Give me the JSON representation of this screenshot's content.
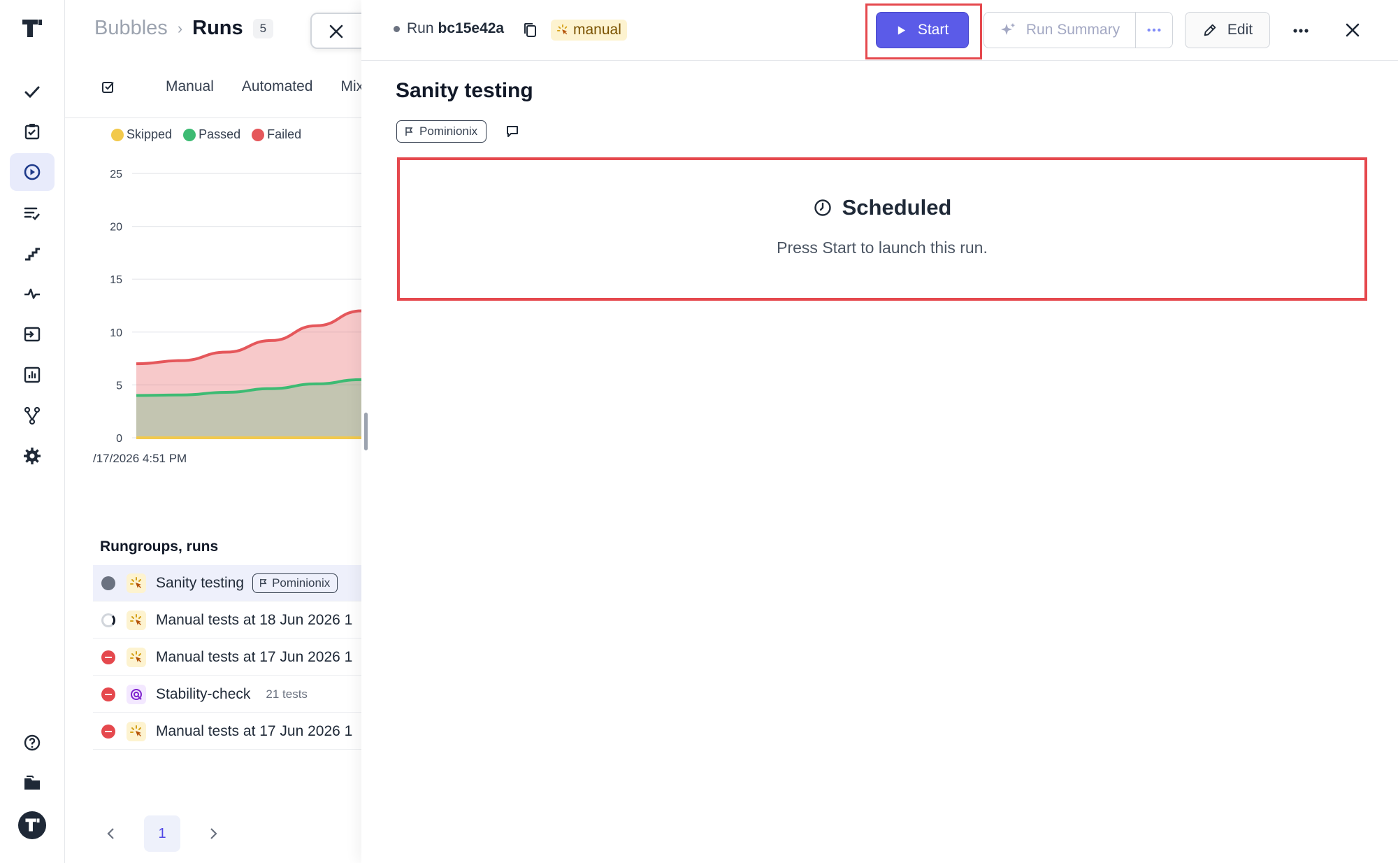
{
  "sidebar": {
    "items": [
      {
        "name": "logo-icon"
      },
      {
        "name": "checkmark-icon"
      },
      {
        "name": "clipboard-check-icon"
      },
      {
        "name": "play-circle-icon"
      },
      {
        "name": "list-check-icon"
      },
      {
        "name": "steps-icon"
      },
      {
        "name": "pulse-icon"
      },
      {
        "name": "import-icon"
      },
      {
        "name": "bar-chart-icon"
      },
      {
        "name": "branch-icon"
      },
      {
        "name": "gear-icon"
      },
      {
        "name": "help-icon"
      },
      {
        "name": "folder-icon"
      },
      {
        "name": "avatar"
      }
    ],
    "active": "play-circle-icon"
  },
  "breadcrumb": {
    "root": "Bubbles",
    "separator": "›",
    "current": "Runs",
    "count": "5"
  },
  "tabs": [
    "Manual",
    "Automated",
    "Mix"
  ],
  "legend": [
    {
      "label": "Skipped",
      "color": "#f2c94c"
    },
    {
      "label": "Passed",
      "color": "#3dbb73"
    },
    {
      "label": "Failed",
      "color": "#e5575b"
    }
  ],
  "chart_data": {
    "type": "area",
    "x_label_shown": "/17/2026 4:51 PM",
    "ylim": [
      0,
      25
    ],
    "yticks": [
      0,
      5,
      10,
      15,
      20,
      25
    ],
    "x": [
      0,
      1,
      2,
      3,
      4,
      5
    ],
    "series": [
      {
        "name": "Skipped",
        "values": [
          0,
          0,
          0,
          0,
          0,
          0
        ]
      },
      {
        "name": "Passed",
        "values": [
          4,
          4.05,
          4.3,
          4.65,
          5.1,
          5.5
        ]
      },
      {
        "name": "Failed",
        "values": [
          7,
          7.3,
          8.1,
          9.2,
          10.6,
          12
        ]
      }
    ],
    "grid": true
  },
  "runs_section": {
    "title": "Rungroups, runs"
  },
  "runs": [
    {
      "status": "gray",
      "type": "manual",
      "title": "Sanity testing",
      "tag": "Pominionix",
      "selected": true
    },
    {
      "status": "pending",
      "type": "manual",
      "title": "Manual tests at 18 Jun 2026 1"
    },
    {
      "status": "red",
      "type": "manual",
      "title": "Manual tests at 17 Jun 2026 1"
    },
    {
      "status": "red",
      "type": "auto",
      "title": "Stability-check",
      "meta": "21 tests"
    },
    {
      "status": "red",
      "type": "manual",
      "title": "Manual tests at 17 Jun 2026 1"
    }
  ],
  "pager": {
    "current": "1"
  },
  "detail": {
    "run_label": "Run",
    "run_id": "bc15e42a",
    "badge": "manual",
    "start_label": "Start",
    "summary_label": "Run Summary",
    "edit_label": "Edit",
    "title": "Sanity testing",
    "milestone": "Pominionix",
    "state_title": "Scheduled",
    "state_text": "Press Start to launch this run."
  },
  "colors": {
    "accent": "#5b5be8",
    "highlight": "#e5484d",
    "failed": "#e5575b",
    "passed": "#3dbb73",
    "skipped": "#f2c94c"
  }
}
